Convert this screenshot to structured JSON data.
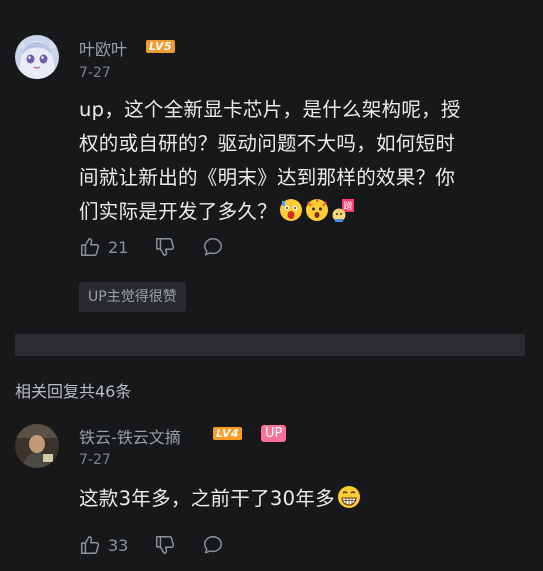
{
  "main_comment": {
    "username": "叶欧叶",
    "level_badge": "LV5",
    "level_color": "#f09a33",
    "date": "7-27",
    "content_lines": [
      "up，这个全新显卡芯片，是什么架构呢，授",
      "权的或自研的？驱动问题不大吗，如何短时",
      "间就让新出的《明末》达到那样的效果？你",
      "们实际是开发了多久？"
    ],
    "emojis": [
      "scared-emoji",
      "shocked-emoji",
      "rub-emoji"
    ],
    "like_count": "21",
    "up_liked_label": "UP主觉得很赞"
  },
  "replies_heading": "相关回复共46条",
  "reply": {
    "username": "铁云-铁云文摘",
    "level_badge": "LV4",
    "level_color": "#ff9a22",
    "up_badge": "UP",
    "up_badge_color": "#fb7299",
    "date": "7-27",
    "content": "这款3年多，之前干了30年多",
    "emoji": "grin-emoji",
    "like_count": "33"
  }
}
